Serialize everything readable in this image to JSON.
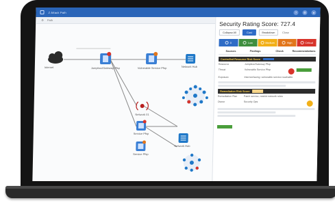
{
  "window": {
    "title": "Z Attack Path"
  },
  "breadcrumb": {
    "label": "Path"
  },
  "graph": {
    "nodes": [
      {
        "label": "Internet"
      },
      {
        "label": "Jumpbox/Gateway Pfsp"
      },
      {
        "label": "Vulnerable Service Pfsp"
      },
      {
        "label": "Network Hub"
      },
      {
        "label": "Network Hub"
      },
      {
        "label": "Service Pfsp"
      },
      {
        "label": "Service Pfsp"
      },
      {
        "label": "Network 01"
      }
    ]
  },
  "panel": {
    "title": "Security Rating Score: 727.4",
    "buttons": {
      "outline": "Collapse All",
      "primary": "Cost",
      "link": "Breakdown",
      "plain": "Close"
    },
    "rating": [
      {
        "label": "0",
        "color": "#2f6cc6"
      },
      {
        "label": "Low",
        "color": "#3f8f3f"
      },
      {
        "label": "Medium",
        "color": "#f2b019"
      },
      {
        "label": "High",
        "color": "#e2761b"
      },
      {
        "label": "Critical",
        "color": "#d8342b"
      }
    ],
    "tabs": [
      "Sources",
      "Findings",
      "Check",
      "Recommendations"
    ],
    "section1": {
      "title": "Controlled Resource Risk Score"
    },
    "section2": {
      "title": "Remediation Risk Score"
    },
    "rows1": [
      {
        "key": "Resource",
        "value": "Jumpbox/Gateway Pfsp"
      },
      {
        "key": "Threat",
        "value": "Vulnerable Service Pfsp"
      },
      {
        "key": "Exposure",
        "value": "Internet-facing: vulnerable service reachable"
      }
    ],
    "rows2": [
      {
        "key": "Remediation Plan",
        "value": "Patch service, restrict network rules"
      },
      {
        "key": "Owner",
        "value": "Security Ops"
      }
    ]
  }
}
